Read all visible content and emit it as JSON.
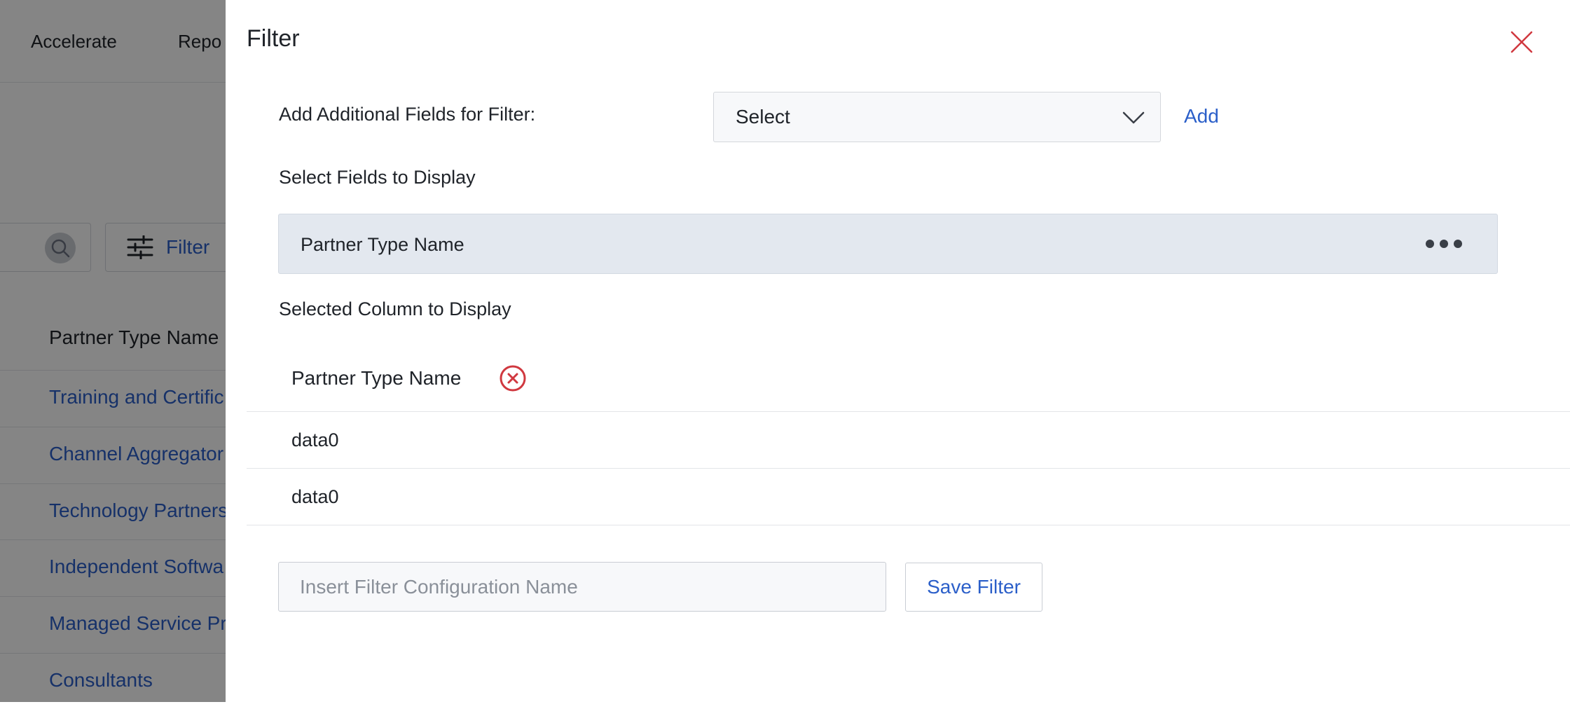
{
  "background": {
    "nav": [
      "Accelerate",
      "Repo"
    ],
    "filter_button": "Filter",
    "column_header": "Partner Type Name",
    "rows": [
      "Training and Certific",
      "Channel Aggregator",
      "Technology Partners",
      "Independent Softwa",
      "Managed Service Pr",
      "Consultants"
    ]
  },
  "drawer": {
    "title": "Filter",
    "add_fields_label": "Add Additional Fields for Filter:",
    "select_value": "Select",
    "add_label": "Add",
    "select_fields_label": "Select Fields to Display",
    "available_field": "Partner Type Name",
    "selected_column_label": "Selected Column to Display",
    "selected_column": {
      "header": "Partner Type Name",
      "rows": [
        "data0",
        "data0"
      ]
    },
    "config_placeholder": "Insert Filter Configuration Name",
    "config_value": "",
    "save_label": "Save Filter"
  },
  "colors": {
    "link": "#2b5fc9",
    "close": "#d0383f",
    "remove": "#d0383f",
    "field_bg": "#e3e8ef"
  },
  "icons": {
    "close": "close-icon",
    "chevron": "chevron-down-icon",
    "more": "more-horizontal-icon",
    "remove": "remove-circle-icon",
    "search": "search-icon",
    "filter": "sliders-icon"
  }
}
